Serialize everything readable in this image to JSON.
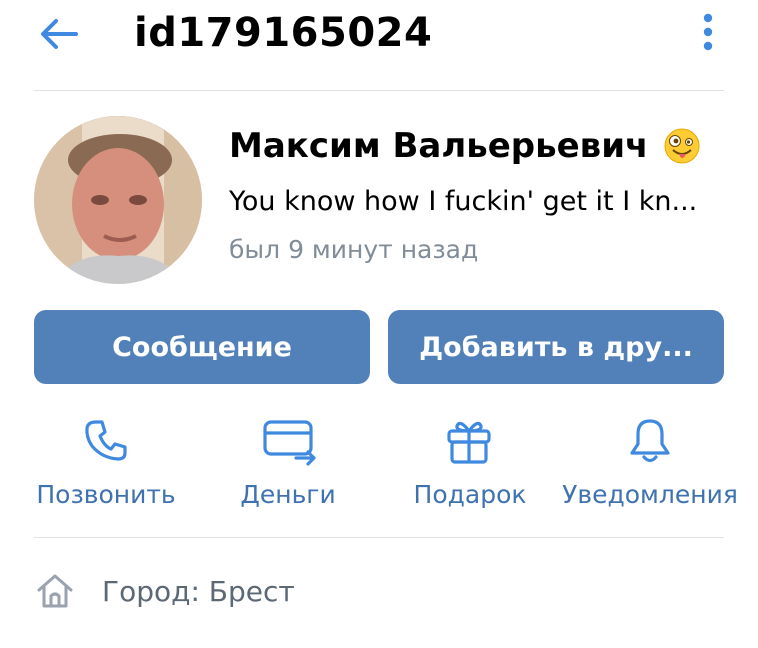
{
  "header": {
    "title": "id179165024",
    "back_icon": "arrow-left-icon",
    "more_icon": "more-vertical-icon"
  },
  "profile": {
    "name": "Максим Вальерьевич",
    "name_emoji": "zany-face-emoji",
    "status": "You know how I fuckin' get it  I kn...",
    "last_seen": "был 9 минут назад"
  },
  "buttons": {
    "message": "Сообщение",
    "add_friend": "Добавить в дру..."
  },
  "actions": [
    {
      "label": "Позвонить",
      "icon": "phone-icon"
    },
    {
      "label": "Деньги",
      "icon": "money-transfer-icon"
    },
    {
      "label": "Подарок",
      "icon": "gift-icon"
    },
    {
      "label": "Уведомления",
      "icon": "bell-icon"
    }
  ],
  "info": {
    "city": "Город: Брест",
    "city_icon": "home-icon"
  },
  "colors": {
    "accent": "#5181b8",
    "link": "#3f72b0",
    "muted": "#818c99"
  }
}
